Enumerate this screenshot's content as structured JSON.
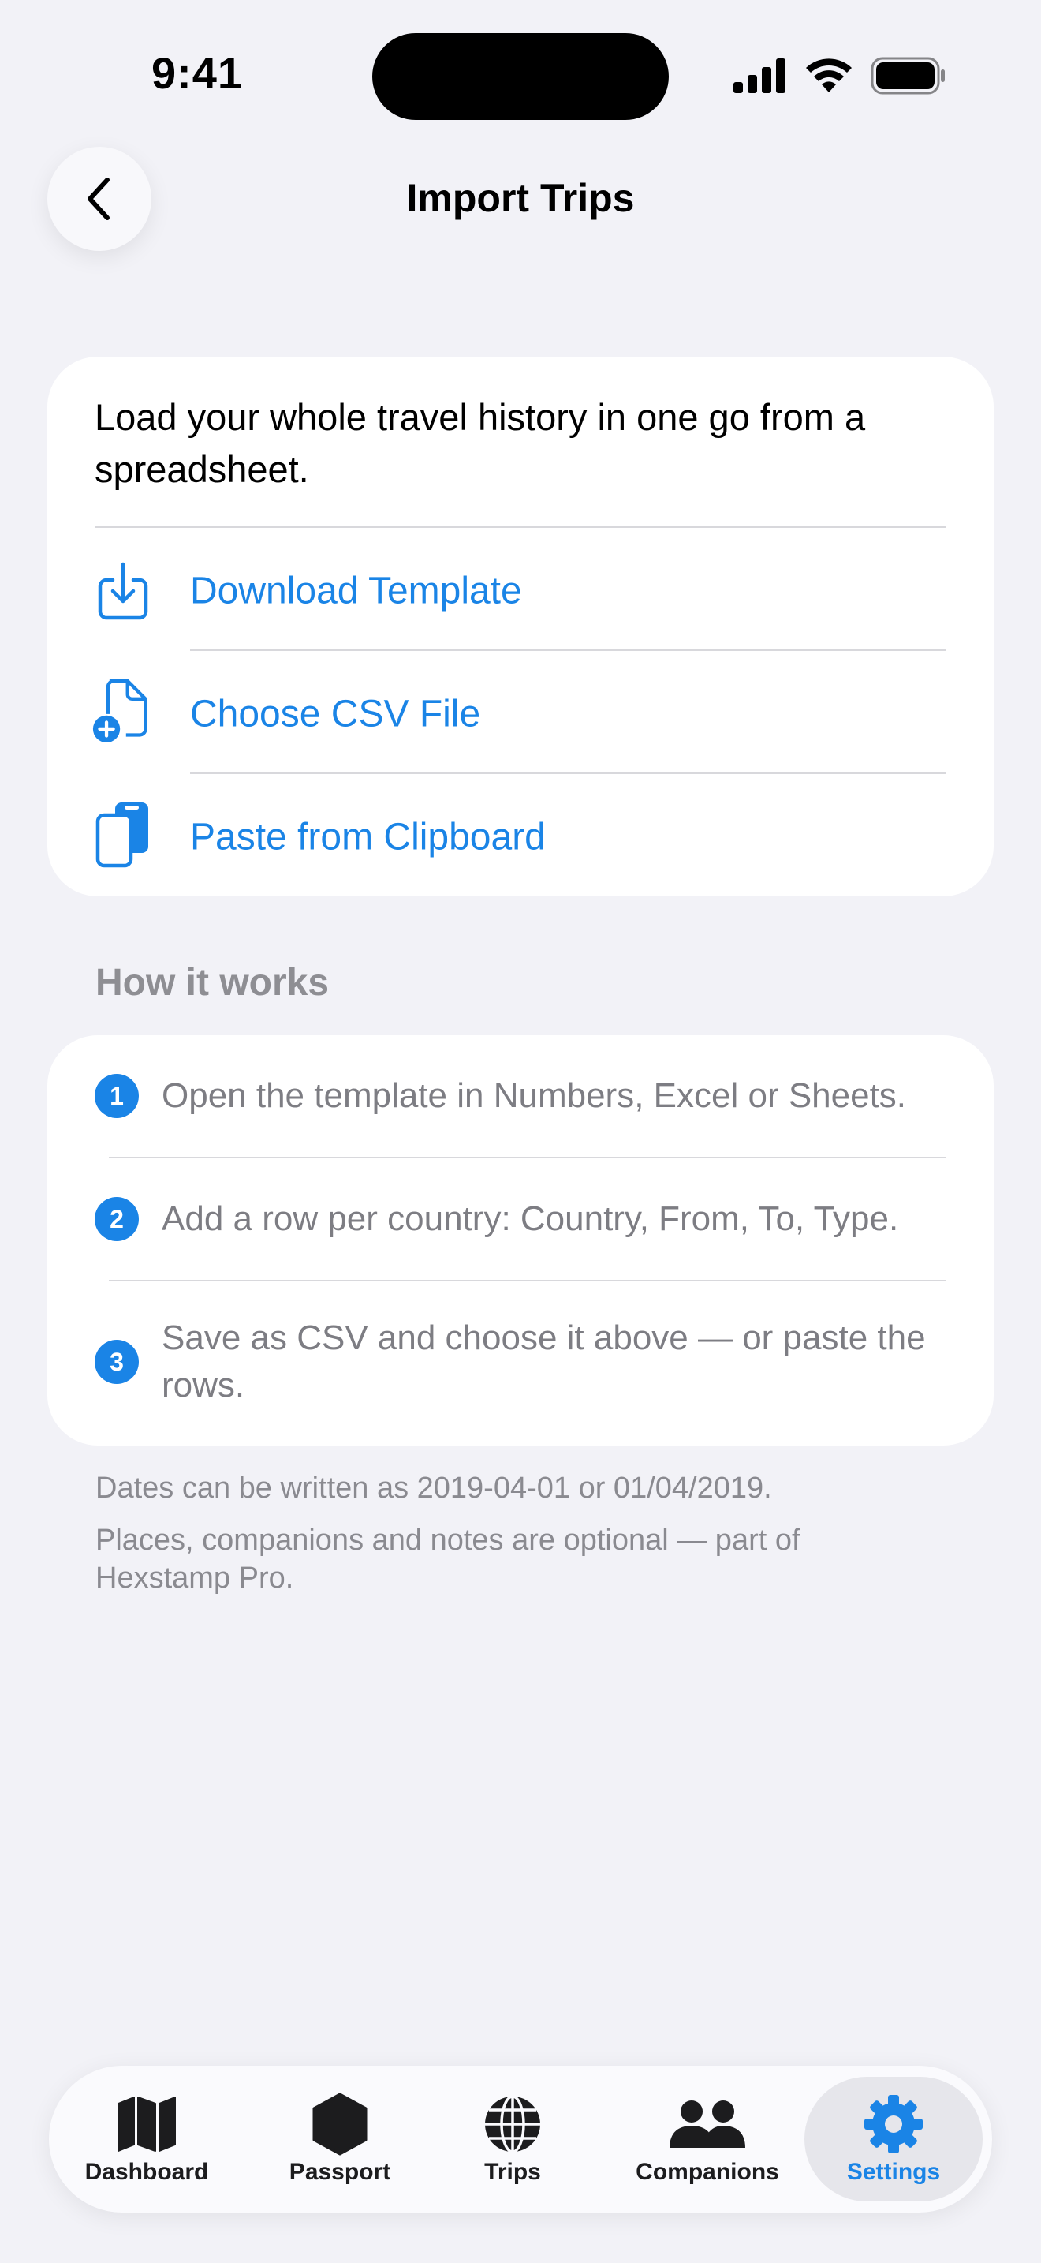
{
  "status_bar": {
    "time": "9:41"
  },
  "nav": {
    "title": "Import Trips",
    "back_icon": "chevron-left-icon"
  },
  "import_card": {
    "intro": "Load your whole travel history in one go from a spreadsheet.",
    "actions": [
      {
        "label": "Download Template",
        "icon": "download-icon"
      },
      {
        "label": "Choose CSV File",
        "icon": "add-document-icon"
      },
      {
        "label": "Paste from Clipboard",
        "icon": "clipboard-icon"
      }
    ]
  },
  "how_it_works": {
    "header": "How it works",
    "steps": [
      {
        "num": "1",
        "text": "Open the template in Numbers, Excel or Sheets."
      },
      {
        "num": "2",
        "text": "Add a row per country: Country, From, To, Type."
      },
      {
        "num": "3",
        "text": "Save as CSV and choose it above — or paste the rows."
      }
    ]
  },
  "footnotes": [
    "Dates can be written as 2019-04-01 or 01/04/2019.",
    "Places, companions and notes are optional — part of Hexstamp Pro."
  ],
  "tab_bar": {
    "tabs": [
      {
        "label": "Dashboard",
        "icon": "map-icon"
      },
      {
        "label": "Passport",
        "icon": "hexagon-icon"
      },
      {
        "label": "Trips",
        "icon": "globe-icon"
      },
      {
        "label": "Companions",
        "icon": "people-icon"
      },
      {
        "label": "Settings",
        "icon": "gear-icon"
      }
    ],
    "active": "Settings"
  },
  "colors": {
    "accent": "#1A84E6",
    "background": "#F2F2F7",
    "secondary_text": "#8E8E93"
  }
}
